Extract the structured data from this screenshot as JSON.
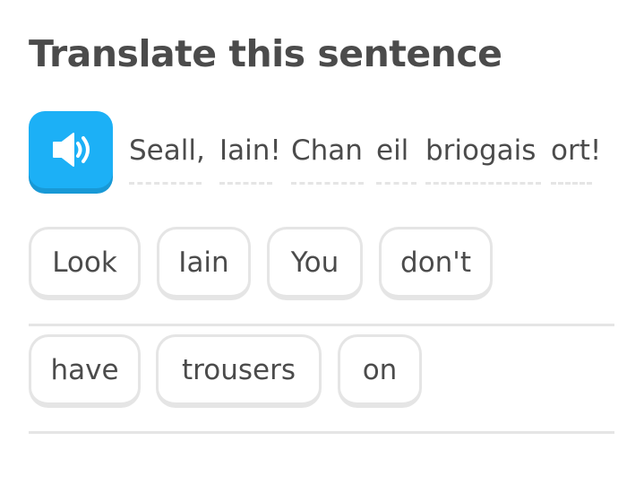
{
  "title": "Translate this sentence",
  "speaker": {
    "icon": "speaker-icon",
    "color": "#1cb0f6"
  },
  "prompt_words": [
    "Seall,",
    "Iain!",
    "Chan",
    "eil",
    "briogais",
    "ort!"
  ],
  "answer_tiles": [
    "Look",
    "Iain",
    "You",
    "don't",
    "have",
    "trousers",
    "on"
  ],
  "colors": {
    "accent": "#1cb0f6",
    "accent_shadow": "#1899d6",
    "tile_border": "#e5e5e5",
    "text": "#4b4b4b"
  }
}
